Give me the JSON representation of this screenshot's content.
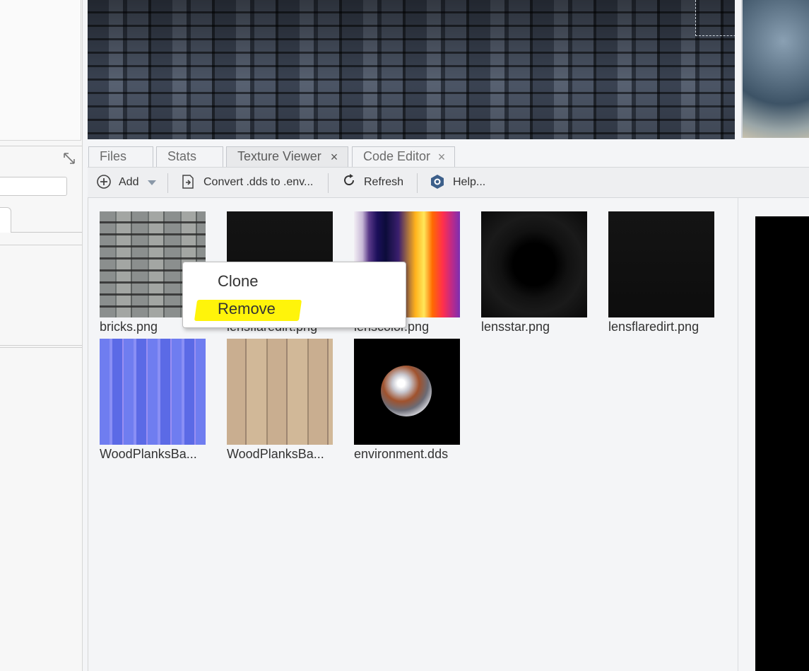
{
  "tabs": [
    {
      "label": "Files"
    },
    {
      "label": "Stats"
    },
    {
      "label": "Texture Viewer"
    },
    {
      "label": "Code Editor"
    }
  ],
  "toolbar": {
    "add_label": "Add",
    "convert_label": "Convert .dds to .env...",
    "refresh_label": "Refresh",
    "help_label": "Help..."
  },
  "textures": [
    {
      "name": "bricks.png"
    },
    {
      "name": "lensflaredirt.png"
    },
    {
      "name": "lenscolor.png"
    },
    {
      "name": "lensstar.png"
    },
    {
      "name": "lensflaredirt.png"
    },
    {
      "name": "WoodPlanksBa..."
    },
    {
      "name": "WoodPlanksBa..."
    },
    {
      "name": "environment.dds"
    }
  ],
  "context_menu": {
    "items": [
      {
        "label": "Clone"
      },
      {
        "label": "Remove"
      }
    ],
    "highlight_color": "#fff40a"
  },
  "colors": {
    "panel_bg": "#f4f5f7",
    "tab_bg": "#f3f4f6",
    "toolbar_bg": "#eeeff1"
  }
}
